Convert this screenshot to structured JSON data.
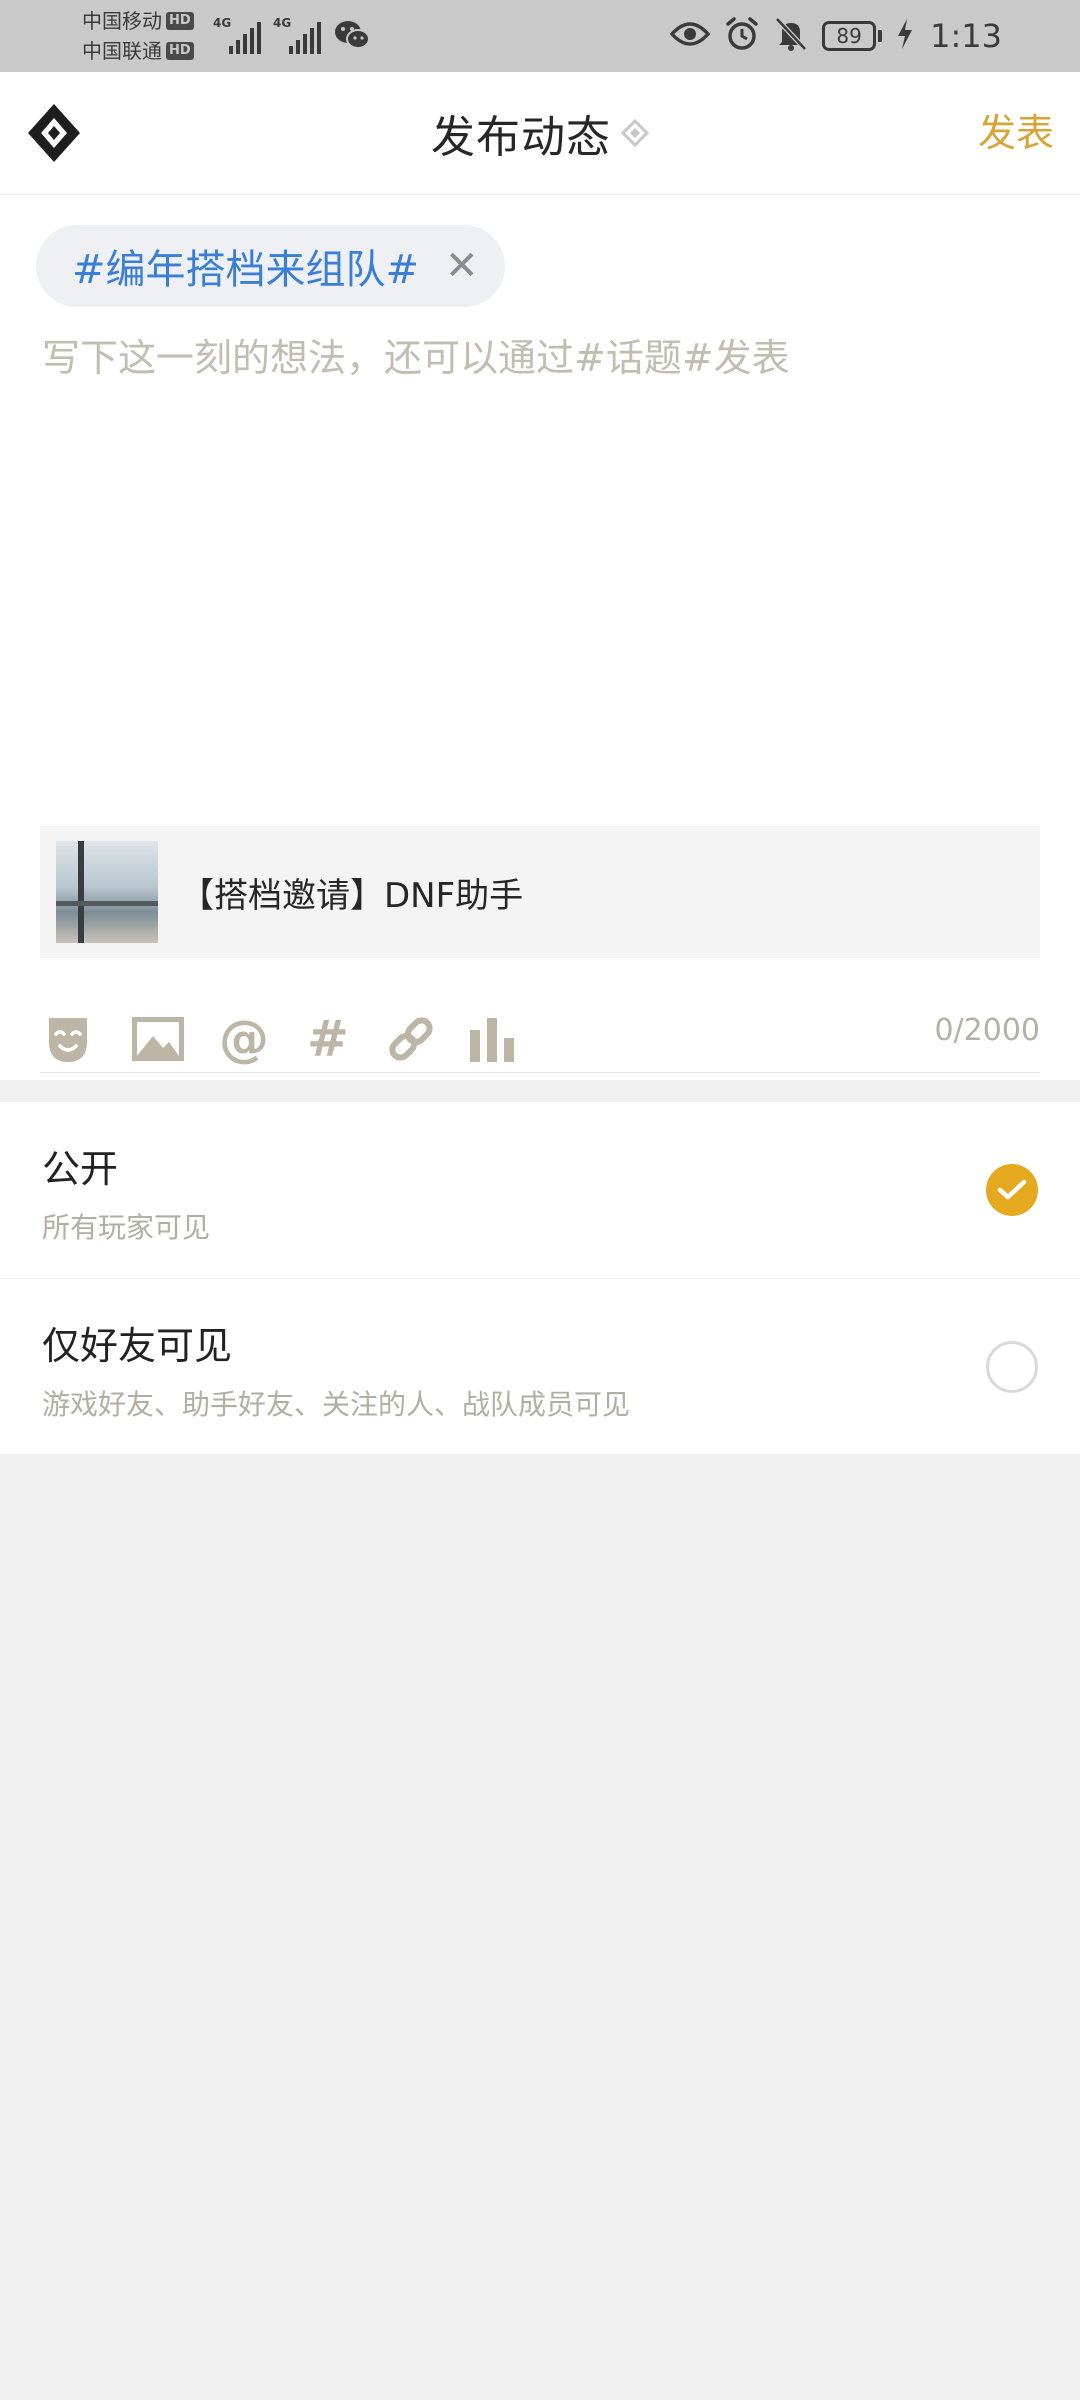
{
  "status_bar": {
    "carrier_1": "中国移动",
    "carrier_2": "中国联通",
    "hd_label": "HD",
    "network_1": "4G",
    "network_2": "4G",
    "battery_level": "89",
    "time": "1:13",
    "icons": [
      "signal-icon",
      "wechat-icon",
      "eye-icon",
      "alarm-icon",
      "bell-off-icon",
      "battery-icon",
      "charging-icon"
    ]
  },
  "header": {
    "title": "发布动态",
    "publish_label": "发表",
    "accent_color": "#d6a537"
  },
  "compose": {
    "topic_tag": "#编年搭档来组队#",
    "input_value": "",
    "input_placeholder": "写下这一刻的想法，还可以通过#话题#发表",
    "share_card": {
      "title": "【搭档邀请】DNF助手"
    },
    "toolbar": {
      "icons": [
        "emoji-icon",
        "image-icon",
        "mention-icon",
        "topic-hashtag-icon",
        "link-icon",
        "poll-chart-icon"
      ],
      "mention_glyph": "@",
      "hashtag_glyph": "#",
      "char_count": "0/2000"
    }
  },
  "visibility": {
    "options": [
      {
        "title": "公开",
        "description": "所有玩家可见",
        "selected": true
      },
      {
        "title": "仅好友可见",
        "description": "游戏好友、助手好友、关注的人、战队成员可见",
        "selected": false
      }
    ],
    "selected_color": "#e5a91f"
  }
}
